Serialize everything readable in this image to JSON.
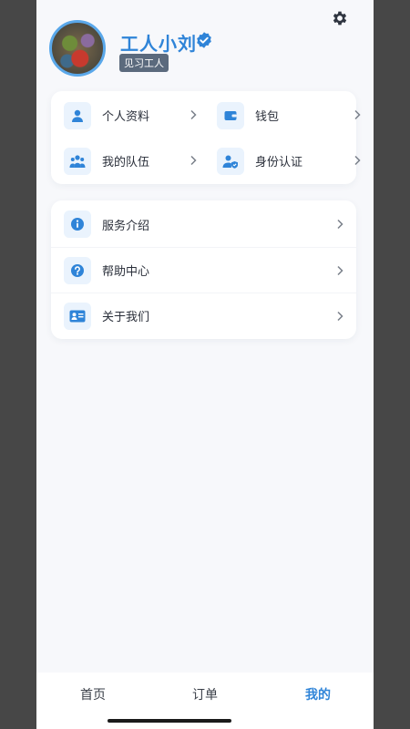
{
  "profile": {
    "name": "工人小刘",
    "role": "见习工人"
  },
  "quick_grid": [
    {
      "label": "个人资料",
      "icon": "person-icon"
    },
    {
      "label": "钱包",
      "icon": "wallet-icon"
    },
    {
      "label": "我的队伍",
      "icon": "team-icon"
    },
    {
      "label": "身份认证",
      "icon": "id-verify-icon"
    }
  ],
  "menu_list": [
    {
      "label": "服务介绍",
      "icon": "info-icon"
    },
    {
      "label": "帮助中心",
      "icon": "help-icon"
    },
    {
      "label": "关于我们",
      "icon": "about-card-icon"
    }
  ],
  "tabbar": {
    "tabs": [
      "首页",
      "订单",
      "我的"
    ],
    "active": "我的"
  },
  "colors": {
    "accent": "#2f84d8",
    "page_bg": "#f7f8fb",
    "icon_bg": "#eaf3fd",
    "badge_bg": "#5b6a7d"
  }
}
